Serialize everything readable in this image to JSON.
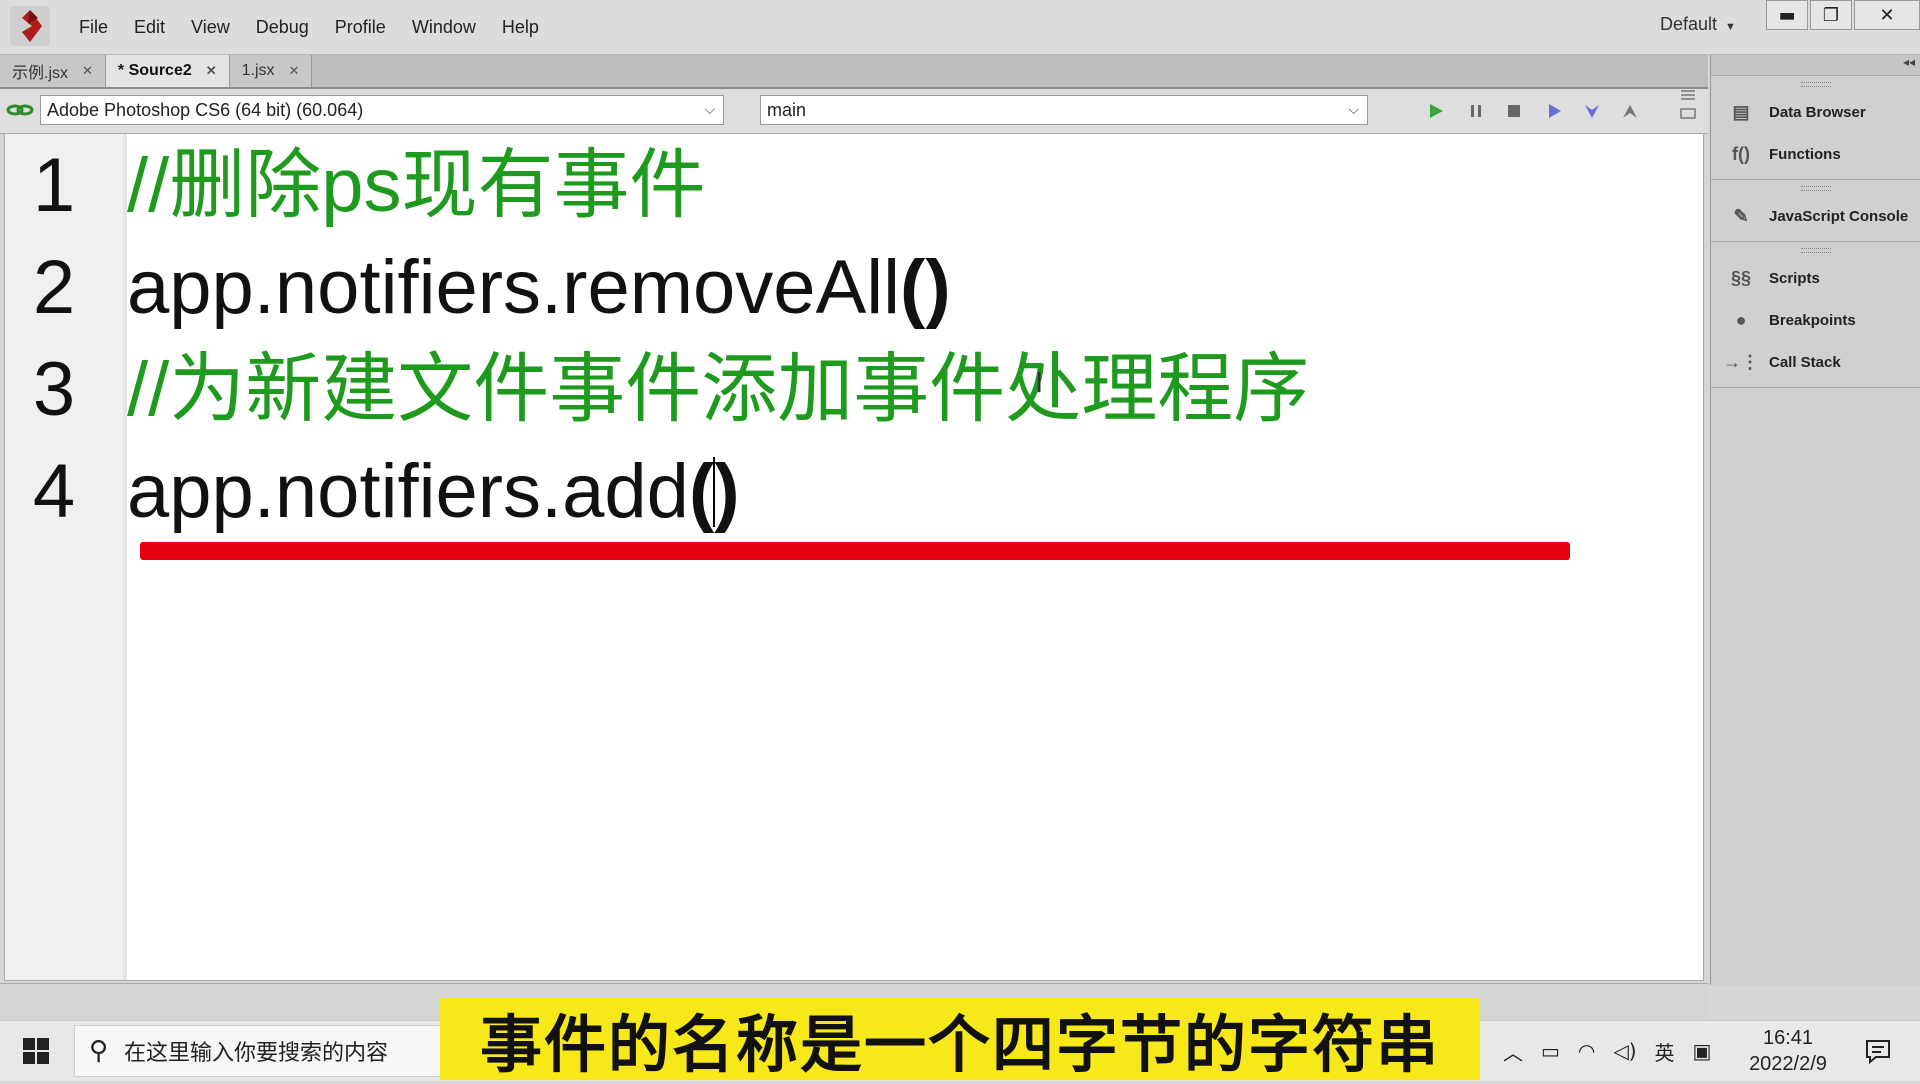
{
  "menubar": {
    "items": [
      "File",
      "Edit",
      "View",
      "Debug",
      "Profile",
      "Window",
      "Help"
    ],
    "workspace": "Default"
  },
  "tabs": [
    {
      "label": "示例.jsx",
      "active": false
    },
    {
      "label": "* Source2",
      "active": true
    },
    {
      "label": "1.jsx",
      "active": false
    }
  ],
  "toolbar": {
    "target_app": "Adobe Photoshop CS6 (64 bit) (60.064)",
    "engine": "main"
  },
  "editor": {
    "lines": [
      {
        "num": "1",
        "text": "//删除ps现有事件",
        "kind": "comment"
      },
      {
        "num": "2",
        "text": "app.notifiers.removeAll",
        "paren": "()",
        "kind": "code"
      },
      {
        "num": "3",
        "text": "//为新建文件事件添加事件处理程序",
        "kind": "comment"
      },
      {
        "num": "4",
        "text": "app.notifiers.add",
        "paren_open": "(",
        "paren_close": ")",
        "kind": "code"
      }
    ],
    "underline_color": "#e5000f",
    "comment_color": "#1e9a1e"
  },
  "side_panel": {
    "groups": [
      [
        {
          "label": "Data Browser",
          "icon": "data-browser-icon"
        },
        {
          "label": "Functions",
          "icon": "functions-icon"
        }
      ],
      [
        {
          "label": "JavaScript Console",
          "icon": "console-icon"
        }
      ],
      [
        {
          "label": "Scripts",
          "icon": "scripts-icon"
        },
        {
          "label": "Breakpoints",
          "icon": "breakpoints-icon"
        },
        {
          "label": "Call Stack",
          "icon": "call-stack-icon"
        }
      ]
    ]
  },
  "taskbar": {
    "search_placeholder": "在这里输入你要搜索的内容",
    "ime": "英",
    "time": "16:41",
    "date": "2022/2/9"
  },
  "subtitle": "事件的名称是一个四字节的字符串"
}
